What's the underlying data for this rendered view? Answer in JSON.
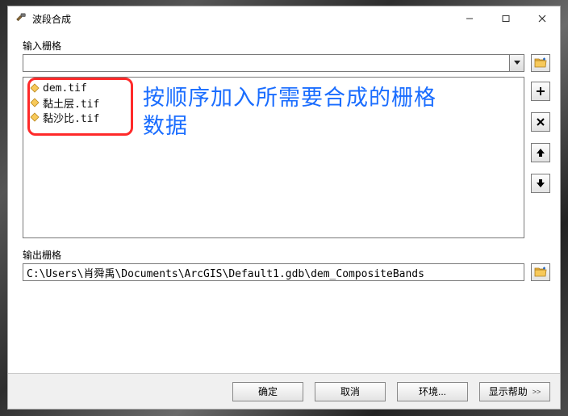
{
  "window": {
    "title": "波段合成"
  },
  "input_section": {
    "label": "输入栅格",
    "combo_value": ""
  },
  "list": {
    "items": [
      {
        "label": "dem.tif"
      },
      {
        "label": "黏土层.tif"
      },
      {
        "label": "黏沙比.tif"
      }
    ]
  },
  "annotation": {
    "text_line1": "按顺序加入所需要合成的栅格",
    "text_line2": "数据"
  },
  "output_section": {
    "label": "输出栅格",
    "value": "C:\\Users\\肖舜禹\\Documents\\ArcGIS\\Default1.gdb\\dem_CompositeBands"
  },
  "buttons": {
    "ok": "确定",
    "cancel": "取消",
    "env": "环境...",
    "help": "显示帮助",
    "help_chev": ">>"
  }
}
